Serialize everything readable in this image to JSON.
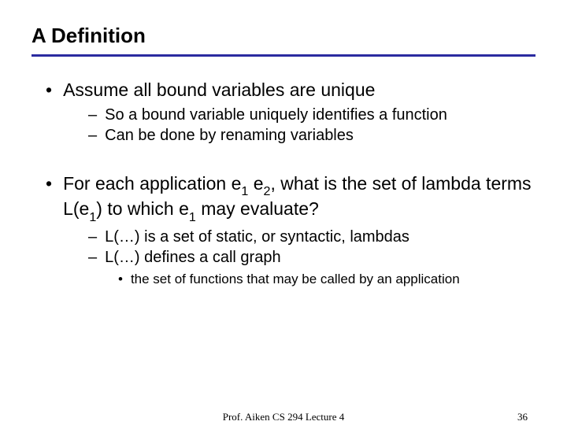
{
  "title": "A Definition",
  "bullets": [
    {
      "text": "Assume all bound variables are unique",
      "subs": [
        {
          "text": "So a bound variable uniquely identifies a function"
        },
        {
          "text": "Can be done by renaming variables"
        }
      ]
    },
    {
      "html": "For each application e<span class='sub'>1</span> e<span class='sub'>2</span>, what is the set of lambda terms L(e<span class='sub'>1</span>) to which e<span class='sub'>1</span> may evaluate?",
      "subs": [
        {
          "text": "L(…) is a set of static, or syntactic, lambdas"
        },
        {
          "text": "L(…) defines a call graph",
          "subs": [
            {
              "text": "the set of functions that may be called by an application"
            }
          ]
        }
      ]
    }
  ],
  "footer": {
    "center": "Prof. Aiken  CS 294  Lecture 4",
    "page": "36"
  }
}
